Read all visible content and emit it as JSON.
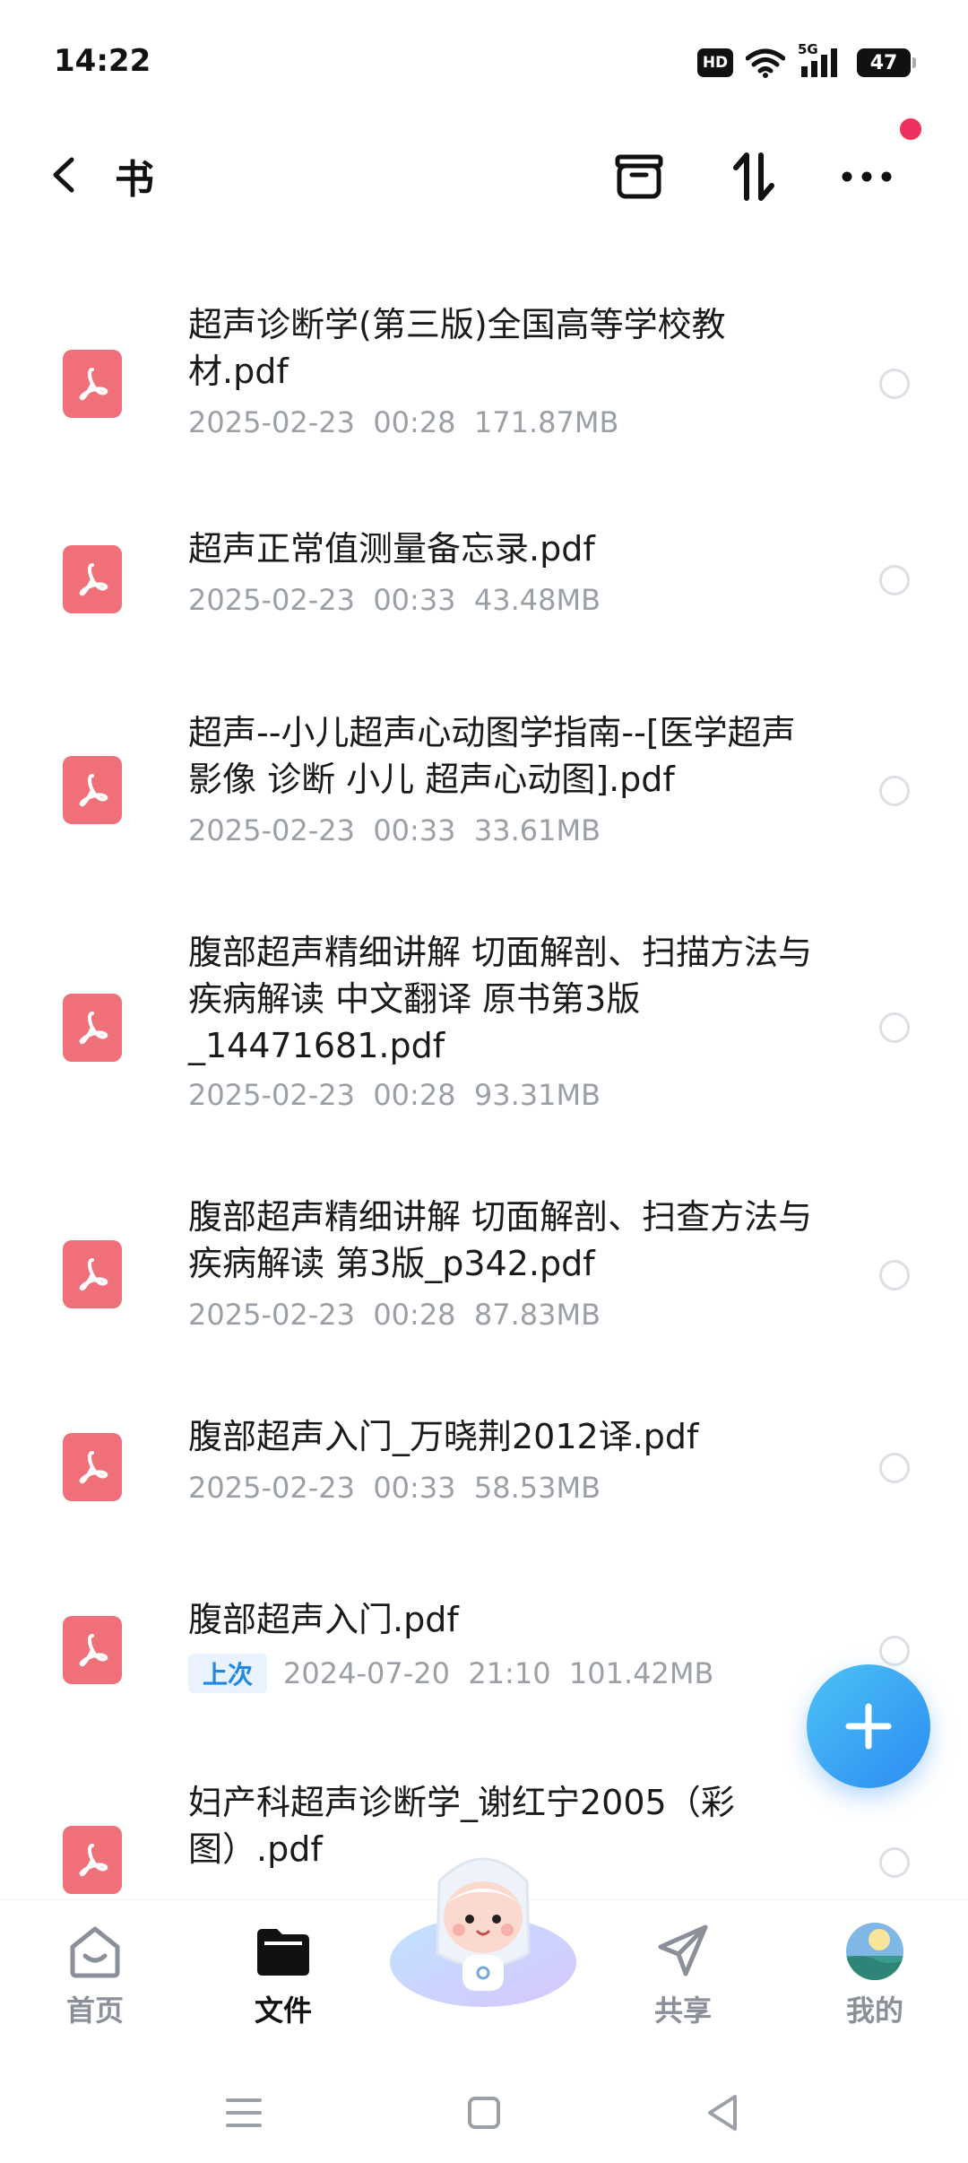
{
  "status_bar": {
    "time": "14:22",
    "hd_label": "HD",
    "network_label": "5G",
    "battery_level": "47"
  },
  "header": {
    "title": "书"
  },
  "files": [
    {
      "name": "超声诊断学(第三版)全国高等学校教材.pdf",
      "meta": "2025-02-23  00:28  171.87MB"
    },
    {
      "name": "超声正常值测量备忘录.pdf",
      "meta": "2025-02-23  00:33  43.48MB"
    },
    {
      "name": "超声--小儿超声心动图学指南--[医学超声 影像 诊断 小儿 超声心动图].pdf",
      "meta": "2025-02-23  00:33  33.61MB"
    },
    {
      "name": "腹部超声精细讲解 切面解剖、扫描方法与疾病解读 中文翻译 原书第3版_14471681.pdf",
      "meta": "2025-02-23  00:28  93.31MB"
    },
    {
      "name": "腹部超声精细讲解  切面解剖、扫查方法与疾病解读  第3版_p342.pdf",
      "meta": "2025-02-23  00:28  87.83MB"
    },
    {
      "name": "腹部超声入门_万晓荆2012译.pdf",
      "meta": "2025-02-23  00:33  58.53MB"
    },
    {
      "name": "腹部超声入门.pdf",
      "tag": "上次",
      "meta": "2024-07-20  21:10  101.42MB"
    },
    {
      "name": "妇产科超声诊断学_谢红宁2005（彩图）.pdf",
      "meta": ""
    }
  ],
  "bottom_nav": {
    "home": "首页",
    "files": "文件",
    "share": "共享",
    "mine": "我的"
  },
  "colors": {
    "pdf_icon": "#f0707a",
    "accent": "#2b8cf2",
    "notify": "#f0315f"
  }
}
